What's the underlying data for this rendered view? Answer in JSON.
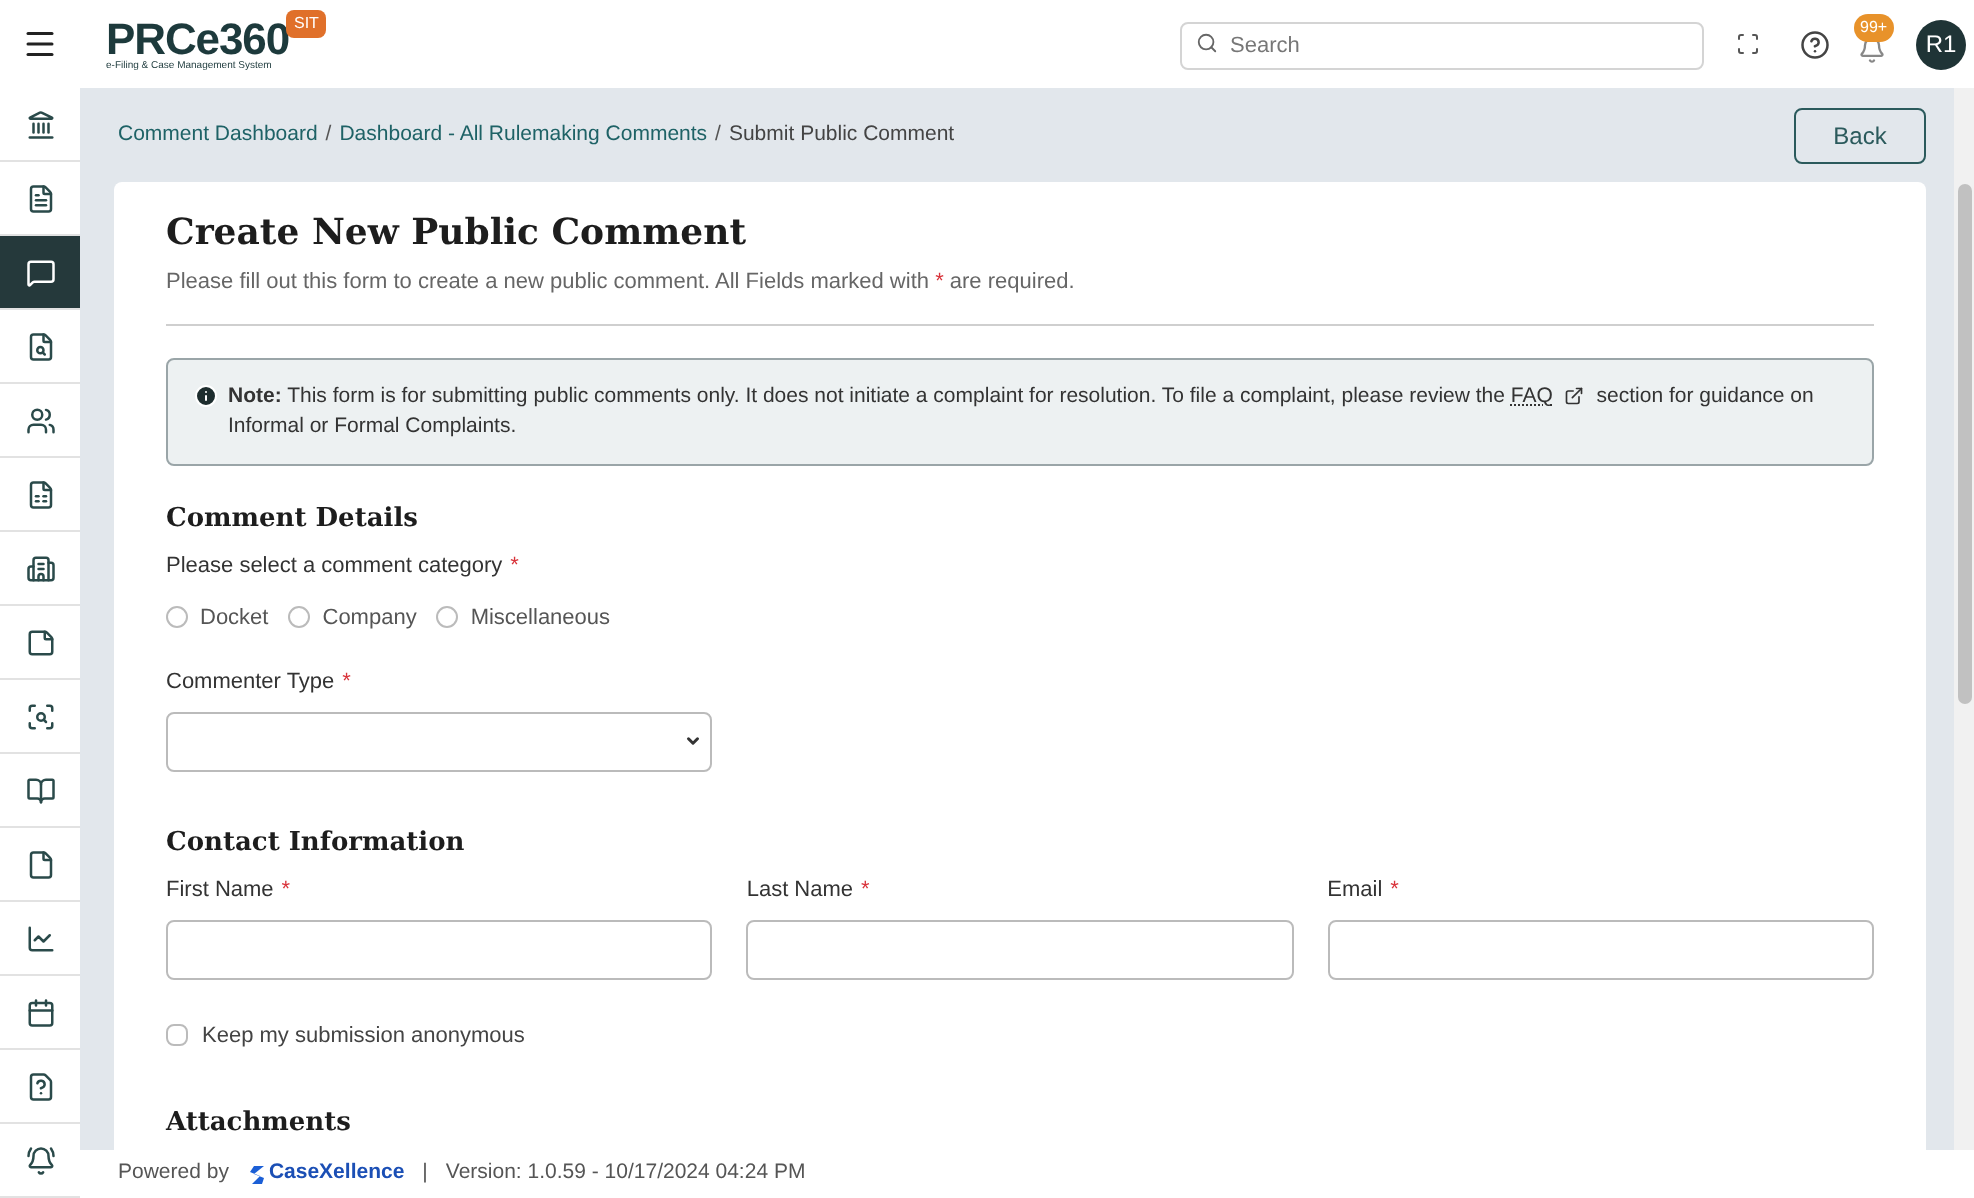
{
  "header": {
    "logo": "PRCe360",
    "logo_tagline": "e-Filing & Case Management System",
    "env_badge": "SIT",
    "search": {
      "placeholder": "Search"
    },
    "notification_count": "99+",
    "avatar": "R1"
  },
  "sidebar": {
    "items": [
      {
        "selected": false
      },
      {
        "selected": false
      },
      {
        "selected": true
      },
      {
        "selected": false
      },
      {
        "selected": false
      },
      {
        "selected": false
      },
      {
        "selected": false
      },
      {
        "selected": false
      },
      {
        "selected": false
      },
      {
        "selected": false
      },
      {
        "selected": false
      },
      {
        "selected": false
      },
      {
        "selected": false
      },
      {
        "selected": false
      },
      {
        "selected": false
      }
    ]
  },
  "breadcrumb": {
    "links": [
      "Comment Dashboard",
      "Dashboard - All Rulemaking Comments"
    ],
    "separator": "/",
    "current": "Submit Public Comment"
  },
  "back_button": "Back",
  "form": {
    "title": "Create New Public Comment",
    "subtitle_before": "Please fill out this form to create a new public comment. All Fields marked with",
    "required_mark": "*",
    "subtitle_after": "are required.",
    "note": {
      "label": "Note:",
      "text": "This form is for submitting public comments only. It does not initiate a complaint for resolution. To file a complaint, please review the",
      "link": "FAQ",
      "text_after": "section for guidance on Informal or Formal Complaints."
    },
    "comment_details": {
      "heading": "Comment Details",
      "category_label": "Please select a comment category",
      "category_required": "*",
      "categories": [
        {
          "label": "Docket",
          "selected": false
        },
        {
          "label": "Company",
          "selected": false
        },
        {
          "label": "Miscellaneous",
          "selected": false
        }
      ],
      "commenter_type_label": "Commenter Type",
      "commenter_type_required": "*"
    },
    "contact": {
      "heading": "Contact Information",
      "fields": [
        {
          "label": "First Name",
          "required": "*"
        },
        {
          "label": "Last Name",
          "required": "*"
        },
        {
          "label": "Email",
          "required": "*"
        }
      ],
      "anonymous": {
        "label": "Keep my submission anonymous",
        "checked": false
      }
    },
    "attachments_heading": "Attachments"
  },
  "footer": {
    "powered_by": "Powered by",
    "brand": "CaseXellence",
    "separator": "|",
    "version": "Version: 1.0.59 - 10/17/2024 04:24 PM"
  }
}
